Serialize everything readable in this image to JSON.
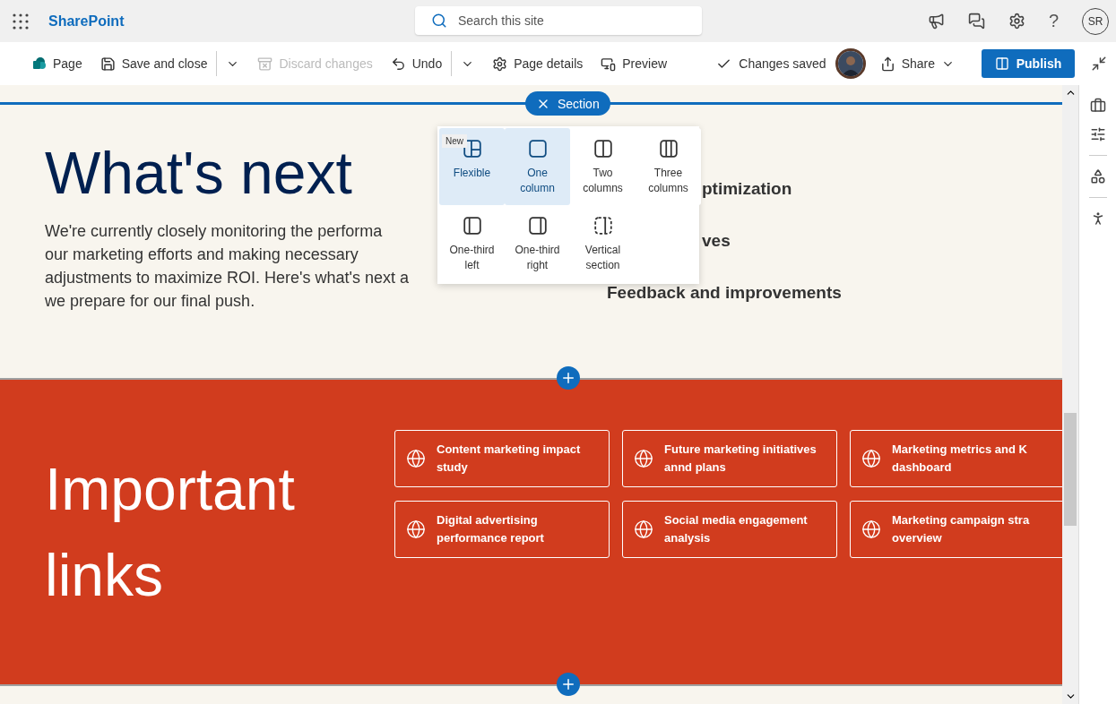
{
  "topbar": {
    "app_name": "SharePoint",
    "search": {
      "placeholder": "Search this site"
    },
    "account_initials": "SR",
    "help": "?"
  },
  "toolbar": {
    "items": [
      {
        "kind": "page",
        "label": "Page",
        "disabled": false
      },
      {
        "kind": "save",
        "label": "Save and close",
        "disabled": false
      },
      {
        "kind": "menu",
        "disabled": false
      },
      {
        "kind": "discard",
        "label": "Discard changes",
        "disabled": true
      },
      {
        "kind": "undo",
        "label": "Undo",
        "disabled": false
      },
      {
        "kind": "menu",
        "disabled": false
      },
      {
        "kind": "details",
        "label": "Page details",
        "disabled": false
      },
      {
        "kind": "preview",
        "label": "Preview",
        "disabled": false
      }
    ],
    "status": "Changes saved",
    "share": "Share",
    "publish": "Publish"
  },
  "section_toolbar": {
    "label": "Section"
  },
  "layout_menu": {
    "items": [
      {
        "kind": "flexible",
        "label": "Flexible",
        "selected": true,
        "badge": "New"
      },
      {
        "kind": "one",
        "label": "One column",
        "selected": true
      },
      {
        "kind": "two",
        "label": "Two columns",
        "selected": false
      },
      {
        "kind": "three",
        "label": "Three columns",
        "selected": false
      },
      {
        "kind": "third-left",
        "label": "One-third left",
        "selected": false
      },
      {
        "kind": "third-right",
        "label": "One-third right",
        "selected": false
      },
      {
        "kind": "vertical",
        "label": "Vertical section",
        "selected": false
      }
    ]
  },
  "sections": [
    {
      "kind": "text",
      "heading": "What's next",
      "paragraph_lines": [
        "We're currently closely monitoring the performa",
        "our marketing efforts and making necessary",
        "adjustments to maximize ROI. Here's what's next a",
        "we prepare for our final push."
      ],
      "list": [
        {
          "text": "ptimization",
          "cut": true
        },
        {
          "text": "ves",
          "cut": true
        },
        {
          "text": "Feedback and improvements",
          "cut": false
        }
      ]
    },
    {
      "kind": "links",
      "heading": "Important links",
      "links": [
        {
          "lines": [
            "Content marketing impact",
            "study"
          ]
        },
        {
          "lines": [
            "Future marketing initiatives",
            "annd plans"
          ]
        },
        {
          "lines": [
            "Marketing metrics and K",
            "dashboard"
          ]
        },
        {
          "lines": [
            "Digital advertising",
            "performance report"
          ]
        },
        {
          "lines": [
            "Social media engagement",
            "analysis"
          ]
        },
        {
          "lines": [
            "Marketing campaign stra",
            "overview"
          ]
        }
      ]
    }
  ]
}
